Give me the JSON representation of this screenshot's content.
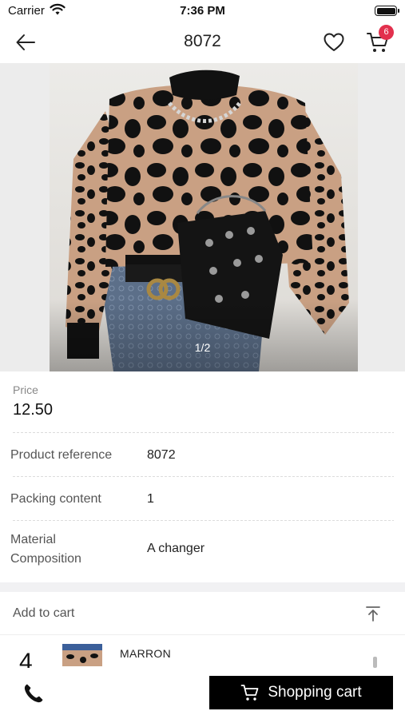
{
  "status_bar": {
    "carrier": "Carrier",
    "time": "7:36 PM"
  },
  "nav": {
    "title": "8072",
    "cart_badge": "6"
  },
  "gallery": {
    "indicator": "1/2"
  },
  "price": {
    "label": "Price",
    "value": "12.50"
  },
  "attributes": [
    {
      "label": "Product reference",
      "value": "8072"
    },
    {
      "label": "Packing content",
      "value": "1"
    },
    {
      "label": "Material Composition",
      "value": "A changer"
    }
  ],
  "add_to_cart": {
    "label": "Add to cart"
  },
  "variant": {
    "quantity": "4",
    "name": "MARRON"
  },
  "bottom_bar": {
    "shopping_cart_label": "Shopping cart"
  },
  "colors": {
    "badge": "#e2304d",
    "button_bg": "#000000"
  },
  "icons": [
    "wifi-icon",
    "battery-icon",
    "back-arrow-icon",
    "heart-icon",
    "cart-icon",
    "collapse-up-icon",
    "phone-icon"
  ]
}
